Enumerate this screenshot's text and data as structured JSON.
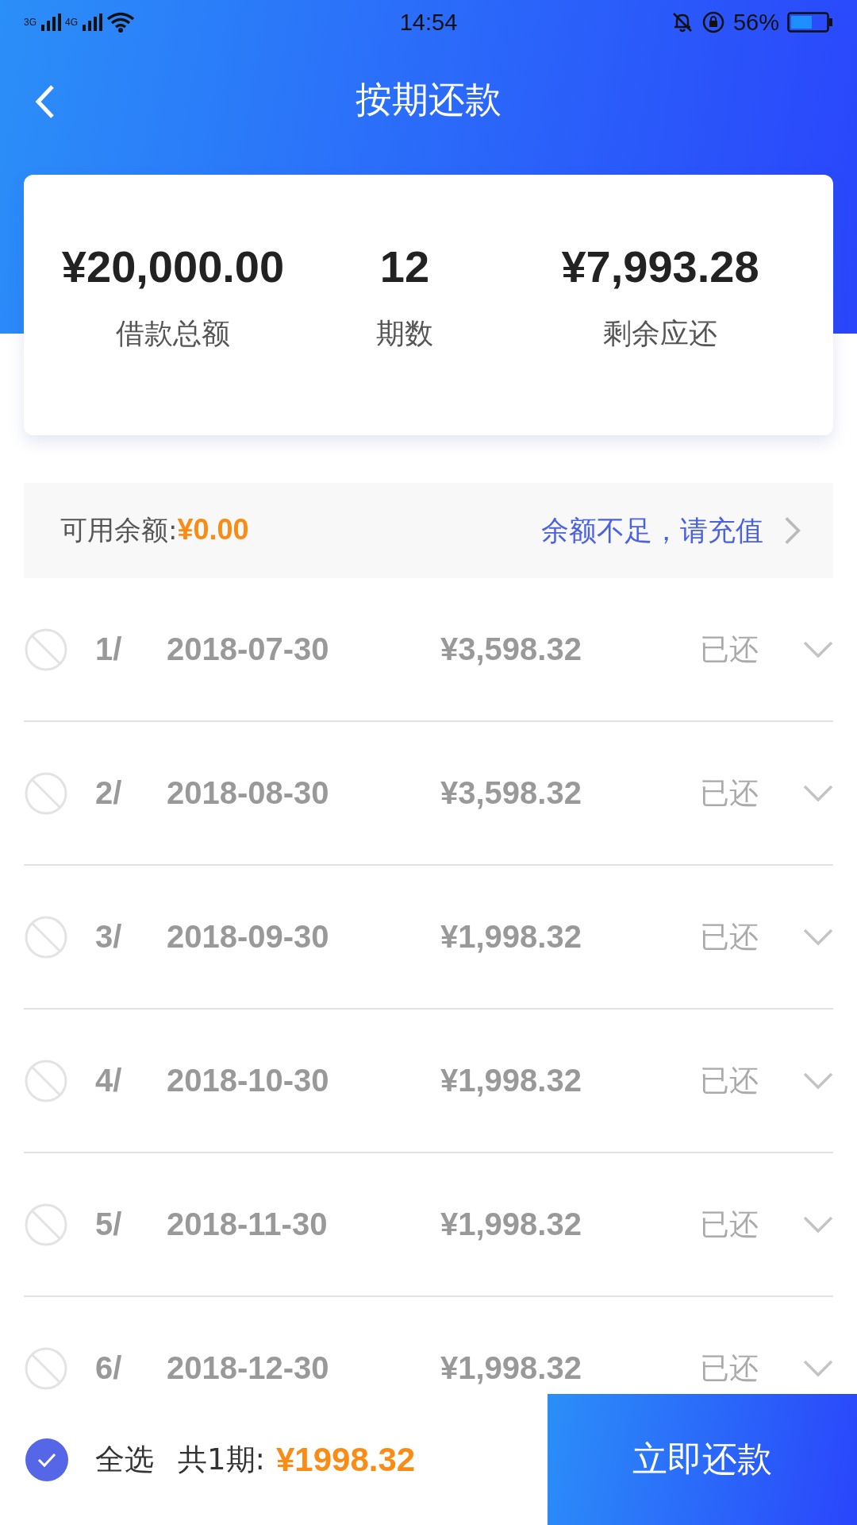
{
  "status_bar": {
    "network_1": "3G",
    "network_2": "4G",
    "time": "14:54",
    "battery": "56%"
  },
  "header": {
    "title": "按期还款"
  },
  "summary": [
    {
      "value": "¥20,000.00",
      "label": "借款总额"
    },
    {
      "value": "12",
      "label": "期数"
    },
    {
      "value": "¥7,993.28",
      "label": "剩余应还"
    }
  ],
  "balance": {
    "label": "可用余额:",
    "amount": "¥0.00",
    "action": "余额不足，请充值"
  },
  "installments": [
    {
      "index": "1/",
      "date": "2018-07-30",
      "amount": "¥3,598.32",
      "status": "已还",
      "disabled": true
    },
    {
      "index": "2/",
      "date": "2018-08-30",
      "amount": "¥3,598.32",
      "status": "已还",
      "disabled": true
    },
    {
      "index": "3/",
      "date": "2018-09-30",
      "amount": "¥1,998.32",
      "status": "已还",
      "disabled": true
    },
    {
      "index": "4/",
      "date": "2018-10-30",
      "amount": "¥1,998.32",
      "status": "已还",
      "disabled": true
    },
    {
      "index": "5/",
      "date": "2018-11-30",
      "amount": "¥1,998.32",
      "status": "已还",
      "disabled": true
    },
    {
      "index": "6/",
      "date": "2018-12-30",
      "amount": "¥1,998.32",
      "status": "已还",
      "disabled": true
    }
  ],
  "footer": {
    "select_all": {
      "label": "全选",
      "checked": true
    },
    "count": "共1期:",
    "total": "¥1998.32",
    "button": "立即还款"
  }
}
